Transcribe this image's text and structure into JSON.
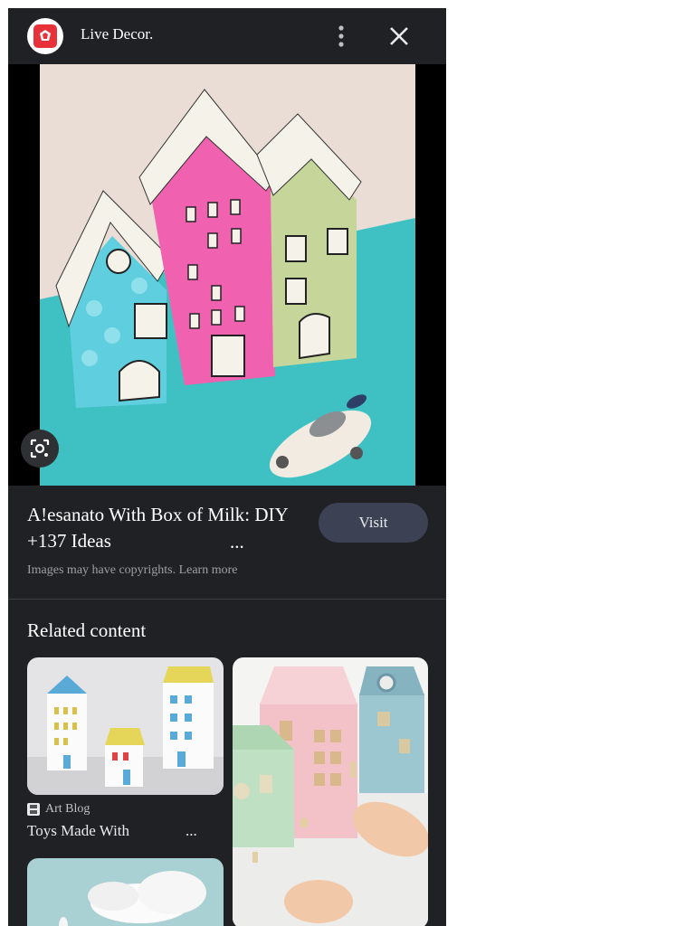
{
  "header": {
    "site_name": "Live Decor.",
    "more_icon": "more-vert-icon",
    "close_icon": "close-icon"
  },
  "result": {
    "title": "A!esanato With Box of Milk: DIY +137 Ideas",
    "ellipsis": "...",
    "visit_label": "Visit",
    "copyright_text": "Images may have copyrights.",
    "learn_more": "Learn more"
  },
  "related": {
    "heading": "Related content",
    "cards": [
      {
        "source": "Art Blog",
        "title": "Toys Made With",
        "more": "..."
      }
    ]
  },
  "colors": {
    "panel_bg": "#202124",
    "visit_button": "#3c4254",
    "brand_red": "#e8323a"
  }
}
